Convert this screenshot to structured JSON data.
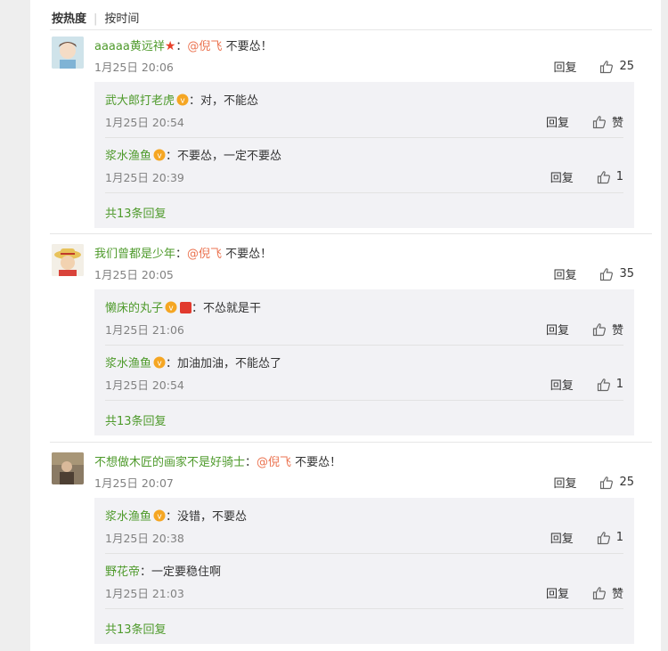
{
  "sort": {
    "hot": "按热度",
    "time": "按时间"
  },
  "comments": [
    {
      "user": "aaaaa黄远祥",
      "sep": "：",
      "mention": "@倪飞",
      "text": " 不要怂！",
      "time": "1月25日 20:06",
      "reply_label": "回复",
      "likes": "25",
      "replies": [
        {
          "user": "武大郎打老虎",
          "sep": "：",
          "text": "对，不能怂",
          "time": "1月25日 20:54",
          "reply_label": "回复",
          "likes": "赞"
        },
        {
          "user": "浆水渔鱼",
          "sep": "：",
          "text": "不要怂，一定不要怂",
          "time": "1月25日 20:39",
          "reply_label": "回复",
          "likes": "1"
        }
      ],
      "more": "共13条回复"
    },
    {
      "user": "我们曾都是少年",
      "sep": "：",
      "mention": "@倪飞",
      "text": " 不要怂！",
      "time": "1月25日 20:05",
      "reply_label": "回复",
      "likes": "35",
      "replies": [
        {
          "user": "懒床的丸子",
          "sep": "：",
          "text": "不怂就是干",
          "time": "1月25日 21:06",
          "reply_label": "回复",
          "likes": "赞"
        },
        {
          "user": "浆水渔鱼",
          "sep": "：",
          "text": "加油加油，不能怂了",
          "time": "1月25日 20:54",
          "reply_label": "回复",
          "likes": "1"
        }
      ],
      "more": "共13条回复"
    },
    {
      "user": "不想做木匠的画家不是好骑士",
      "sep": "：",
      "mention": "@倪飞",
      "text": " 不要怂！",
      "time": "1月25日 20:07",
      "reply_label": "回复",
      "likes": "25",
      "replies": [
        {
          "user": "浆水渔鱼",
          "sep": "：",
          "text": "没错，不要怂",
          "time": "1月25日 20:38",
          "reply_label": "回复",
          "likes": "1"
        },
        {
          "user": "野花帝",
          "sep": "：",
          "text": "一定要稳住啊",
          "time": "1月25日 21:03",
          "reply_label": "回复",
          "likes": "赞"
        }
      ],
      "more": "共13条回复"
    }
  ],
  "colors": {
    "username": "#4e9a2b",
    "mention": "#eb7350",
    "panel": "#ffffff",
    "reply_bg": "#f2f2f5"
  }
}
